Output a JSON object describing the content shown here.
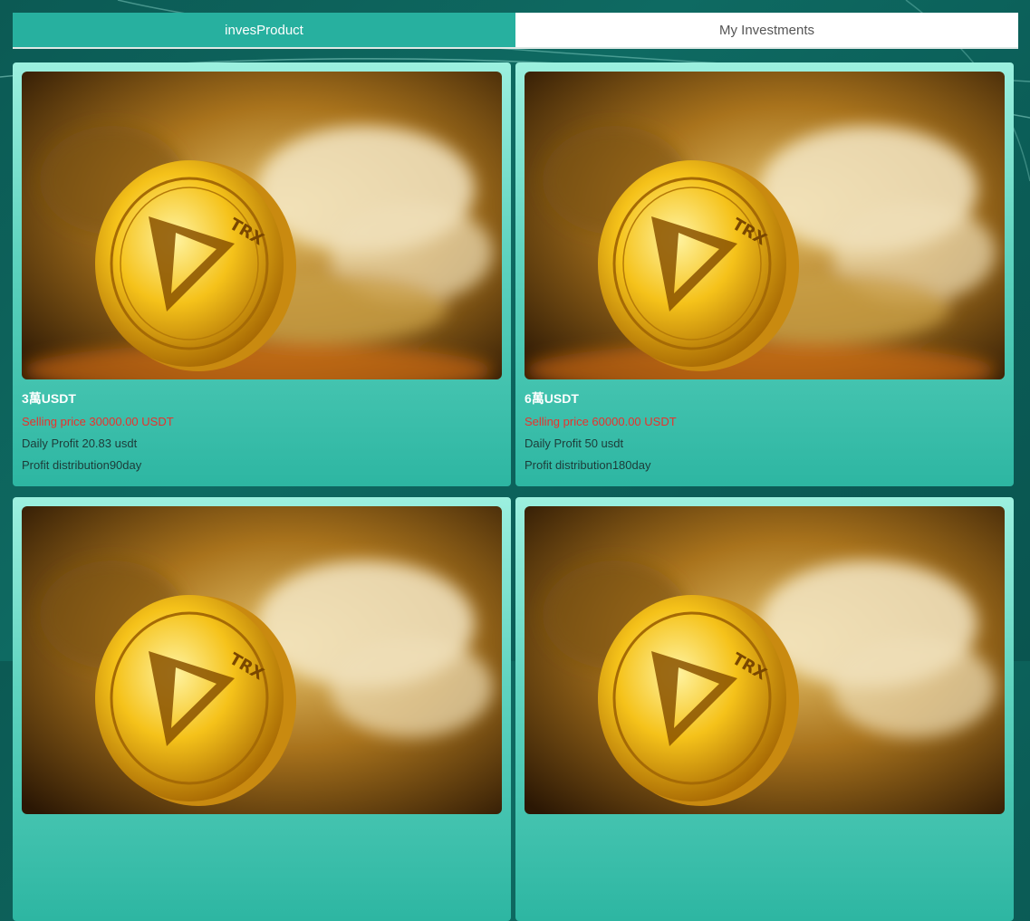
{
  "tabs": [
    {
      "label": "invesProduct",
      "active": true
    },
    {
      "label": "My Investments",
      "active": false
    }
  ],
  "products": [
    {
      "title": "3萬USDT",
      "price": "Selling price 30000.00 USDT",
      "daily_profit": "Daily Profit 20.83 usdt",
      "distribution": "Profit distribution90day",
      "coin_text": "TRX"
    },
    {
      "title": "6萬USDT",
      "price": "Selling price 60000.00 USDT",
      "daily_profit": "Daily Profit 50 usdt",
      "distribution": "Profit distribution180day",
      "coin_text": "TRX"
    },
    {
      "title": "",
      "price": "",
      "daily_profit": "",
      "distribution": "",
      "coin_text": "TRX"
    },
    {
      "title": "",
      "price": "",
      "daily_profit": "",
      "distribution": "",
      "coin_text": "TRX"
    }
  ],
  "colors": {
    "accent": "#27b09f",
    "price": "#e8322c",
    "card_top": "#9cf0df",
    "card_bottom": "#2db6a2"
  }
}
